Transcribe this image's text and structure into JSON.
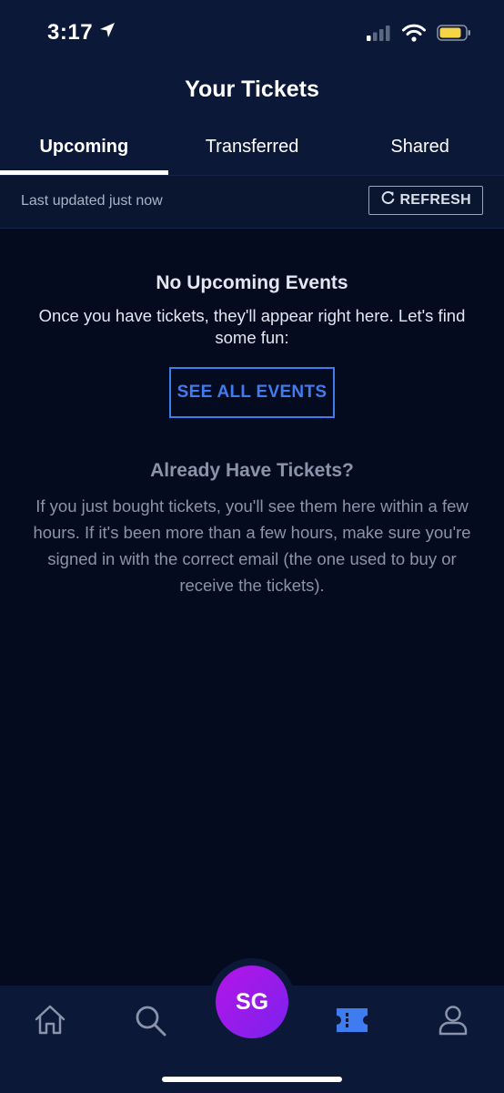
{
  "status_bar": {
    "time": "3:17"
  },
  "header": {
    "title": "Your Tickets",
    "tabs": [
      {
        "label": "Upcoming",
        "active": true
      },
      {
        "label": "Transferred",
        "active": false
      },
      {
        "label": "Shared",
        "active": false
      }
    ]
  },
  "refresh": {
    "last_updated": "Last updated just now",
    "button_label": "REFRESH"
  },
  "empty_state": {
    "title": "No Upcoming Events",
    "text": "Once you have tickets, they'll appear right here. Let's find some fun:",
    "button_label": "SEE ALL EVENTS"
  },
  "already_have": {
    "title": "Already Have Tickets?",
    "text": "If you just bought tickets, you'll see them here within a few hours. If it's been more than a few hours, make sure you're signed in with the correct email (the one used to buy or receive the tickets)."
  },
  "bottom_nav": {
    "avatar_initials": "SG",
    "items": [
      "home-icon",
      "search-icon",
      "avatar",
      "ticket-icon",
      "profile-icon"
    ]
  },
  "colors": {
    "background": "#050b1f",
    "header": "#0b1838",
    "accent": "#3f7cf0",
    "avatar_gradient_start": "#b515e6",
    "avatar_gradient_end": "#7a22ee",
    "battery": "#f5d547"
  }
}
